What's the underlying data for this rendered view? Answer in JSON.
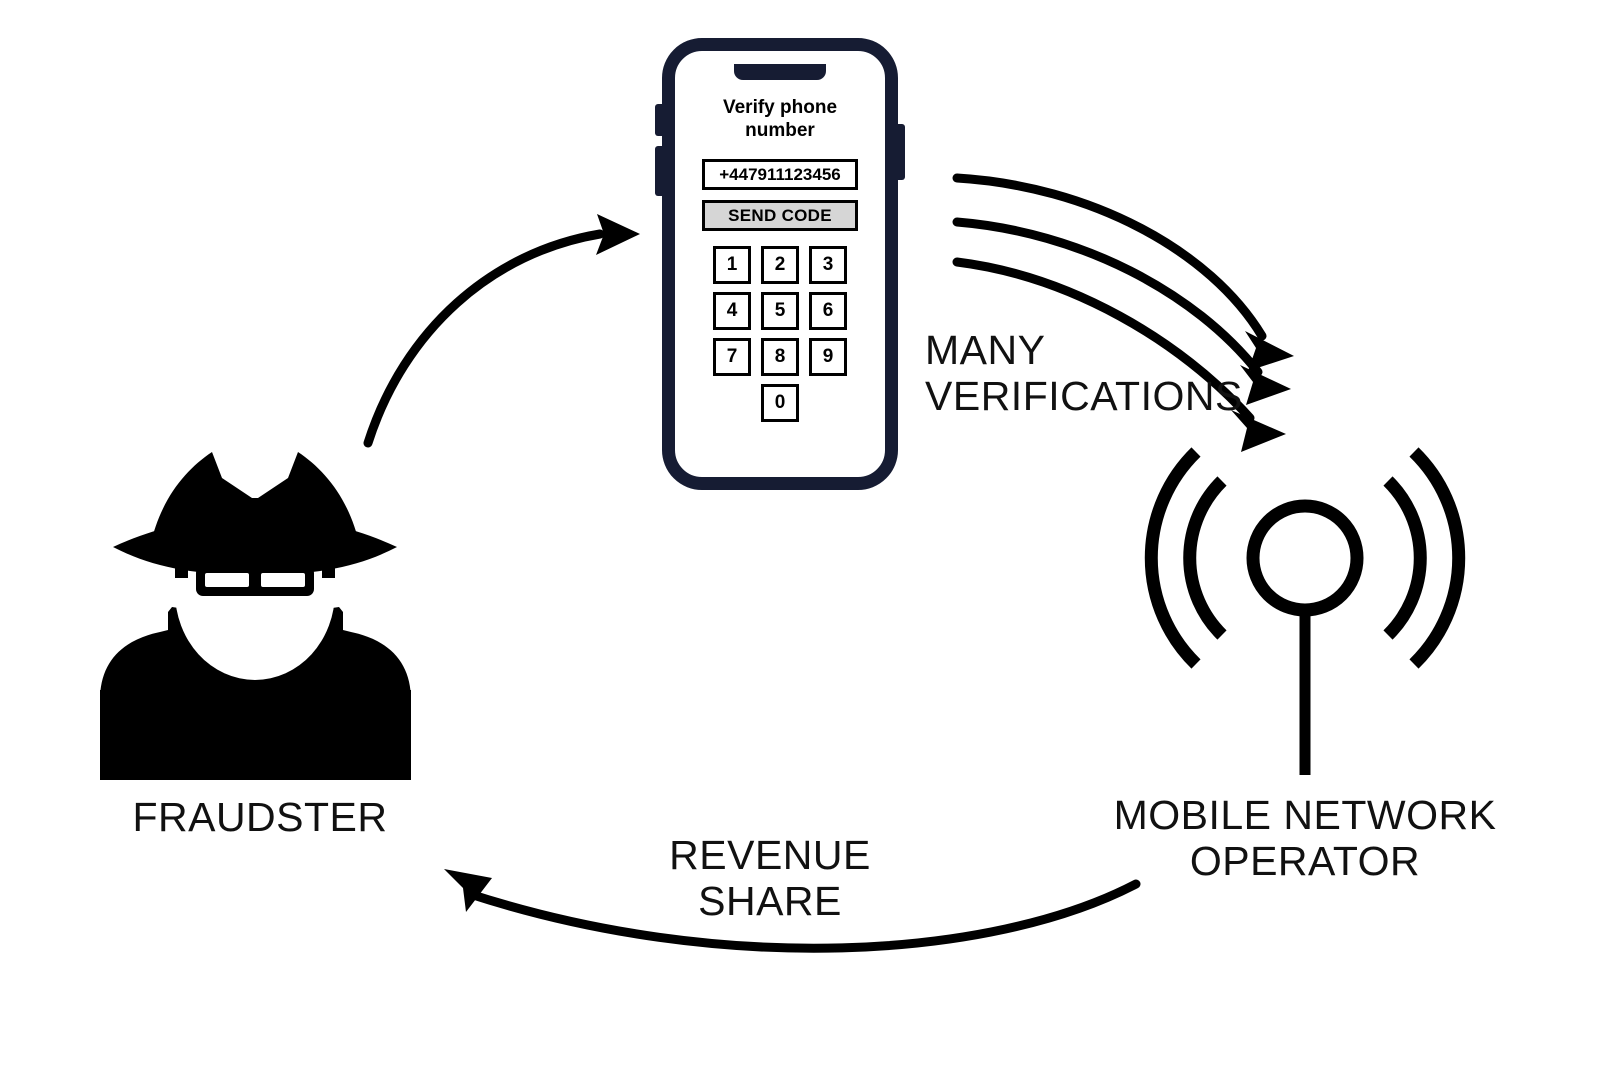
{
  "diagram": {
    "title": "SMS pumping fraud loop",
    "background": "#ffffff",
    "ink": "#000000",
    "phone_frame_color": "#161c33",
    "button_fill": "#d6d6d6"
  },
  "nodes": {
    "fraudster": {
      "label": "FRAUDSTER",
      "icon": "fraudster-hat-glasses-icon"
    },
    "operator": {
      "label": "MOBILE NETWORK\nOPERATOR",
      "icon": "antenna-signal-icon"
    }
  },
  "phone": {
    "screen_title": "Verify phone\nnumber",
    "phone_number": "+447911123456",
    "send_code_label": "SEND CODE",
    "keypad": [
      [
        "1",
        "2",
        "3"
      ],
      [
        "4",
        "5",
        "6"
      ],
      [
        "7",
        "8",
        "9"
      ]
    ],
    "keypad_zero": "0"
  },
  "edges": {
    "fraudster_to_phone": {
      "label": "",
      "arrowheads": 1,
      "direction": "fraudster-to-phone"
    },
    "phone_to_operator": {
      "label": "MANY\nVERIFICATIONS",
      "arrowheads": 3,
      "direction": "phone-to-operator"
    },
    "operator_to_fraudster": {
      "label": "REVENUE\nSHARE",
      "arrowheads": 1,
      "direction": "operator-to-fraudster"
    }
  }
}
